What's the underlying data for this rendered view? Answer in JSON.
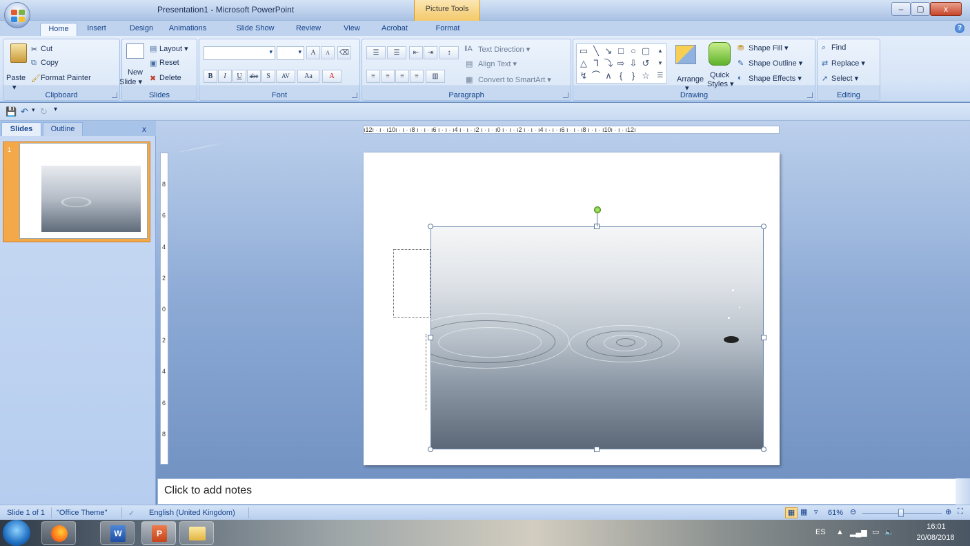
{
  "window": {
    "title": "Presentation1 - Microsoft PowerPoint",
    "contextual_tab_group": "Picture Tools",
    "buttons": {
      "minimize": "–",
      "maximize": "▢",
      "close": "x"
    }
  },
  "tabs": [
    {
      "label": "Home",
      "active": true
    },
    {
      "label": "Insert"
    },
    {
      "label": "Design"
    },
    {
      "label": "Animations"
    },
    {
      "label": "Slide Show"
    },
    {
      "label": "Review"
    },
    {
      "label": "View"
    },
    {
      "label": "Acrobat"
    },
    {
      "label": "Format"
    }
  ],
  "ribbon": {
    "clipboard": {
      "label": "Clipboard",
      "paste": "Paste",
      "cut": "Cut",
      "copy": "Copy",
      "format_painter": "Format Painter"
    },
    "slides": {
      "label": "Slides",
      "new_slide": "New",
      "new_slide_2": "Slide",
      "layout": "Layout",
      "reset": "Reset",
      "delete": "Delete"
    },
    "font": {
      "label": "Font",
      "font_name": "",
      "font_size": "",
      "bold": "B",
      "italic": "I",
      "underline": "U",
      "strike": "abe",
      "shadow": "S",
      "spacing": "AV",
      "change_case": "Aa",
      "font_color": "A",
      "grow": "A",
      "shrink": "A"
    },
    "paragraph": {
      "label": "Paragraph",
      "text_direction": "Text Direction",
      "align_text": "Align Text",
      "convert_smartart": "Convert to SmartArt"
    },
    "drawing": {
      "label": "Drawing",
      "arrange": "Arrange",
      "quick_styles": "Quick",
      "quick_styles_2": "Styles",
      "shape_fill": "Shape Fill",
      "shape_outline": "Shape Outline",
      "shape_effects": "Shape Effects"
    },
    "editing": {
      "label": "Editing",
      "find": "Find",
      "replace": "Replace",
      "select": "Select"
    }
  },
  "panel": {
    "tabs": [
      "Slides",
      "Outline"
    ],
    "close": "x",
    "slide_number": "1"
  },
  "ruler": {
    "horizontal": "ı12ı · ı · ı10ı · ı · ı8 ı · ı · ı6 ı · ı · ı4 ı · ı · ı2 ı · ı · ı0 ı · ı · ı2 ı · ı · ı4 ı · ı · ı6 ı · ı · ı8 ı · ı · ı10ı · ı · ı12ı",
    "vertical_ticks": [
      "8",
      "6",
      "4",
      "2",
      "0",
      "2",
      "4",
      "6",
      "8"
    ]
  },
  "notes": {
    "placeholder": "Click to add notes"
  },
  "status": {
    "slide": "Slide 1 of 1",
    "theme": "\"Office Theme\"",
    "language": "English (United Kingdom)",
    "zoom": "61%"
  },
  "taskbar": {
    "lang": "ES",
    "time": "16:01",
    "date": "20/08/2018"
  },
  "colors": {
    "ribbon_blue": "#15428b",
    "selection_orange": "#f3a94a",
    "rotate_green": "#5eb720"
  }
}
